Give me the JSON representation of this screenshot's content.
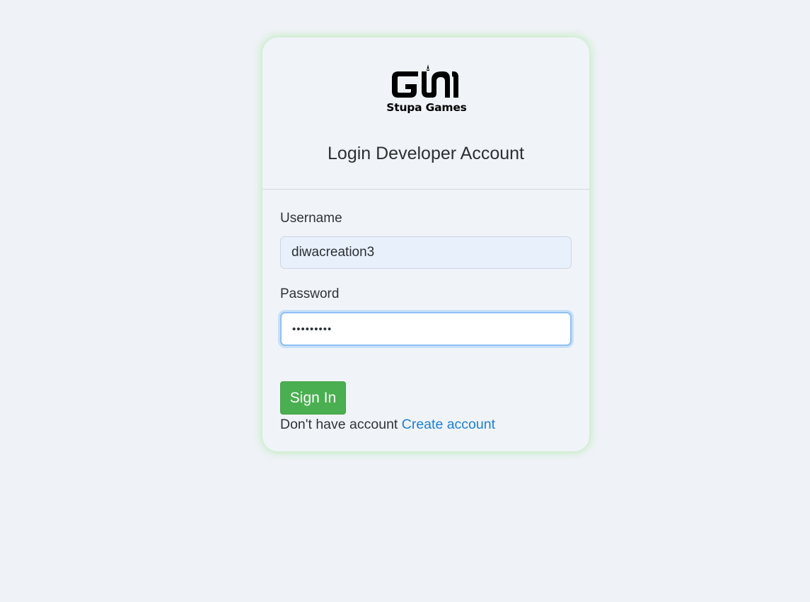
{
  "header": {
    "logo_text": "Stupa Games",
    "title": "Login Developer Account"
  },
  "form": {
    "username_label": "Username",
    "username_value": "diwacreation3",
    "password_label": "Password",
    "password_masked": "•••••••••",
    "submit_label": "Sign In"
  },
  "footer": {
    "prompt_text": "Don't have account",
    "link_text": "Create account"
  },
  "colors": {
    "page_bg": "#eff2f7",
    "card_bg": "#f0f4f9",
    "card_glow": "#9be68c",
    "button_green": "#4aaf50",
    "link_blue": "#1a7fd6",
    "focus_ring": "#8fbff3"
  }
}
